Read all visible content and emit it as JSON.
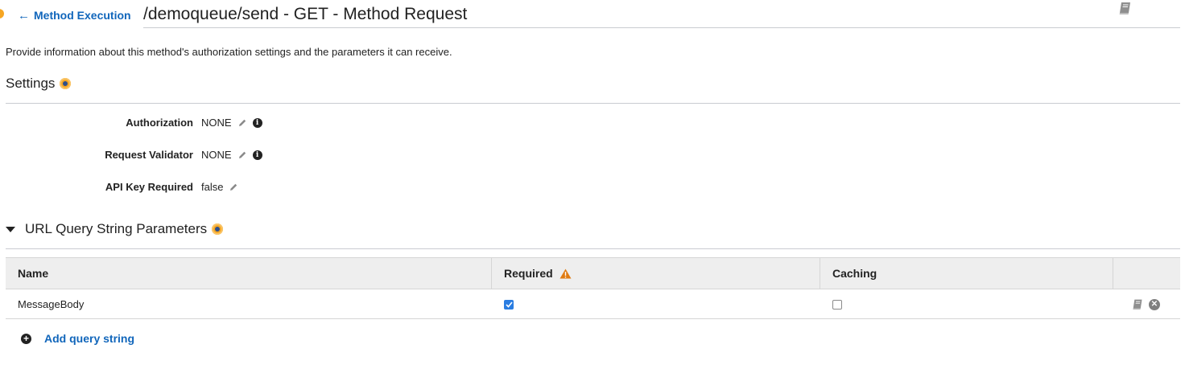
{
  "header": {
    "back_label": "Method Execution",
    "title": "/demoqueue/send - GET - Method Request"
  },
  "description": "Provide information about this method's authorization settings and the parameters it can receive.",
  "settings": {
    "title": "Settings",
    "fields": [
      {
        "label": "Authorization",
        "value": "NONE",
        "editable": true,
        "info": true
      },
      {
        "label": "Request Validator",
        "value": "NONE",
        "editable": true,
        "info": true
      },
      {
        "label": "API Key Required",
        "value": "false",
        "editable": true,
        "info": false
      }
    ]
  },
  "query_params": {
    "title": "URL Query String Parameters",
    "expanded": true,
    "columns": {
      "name": "Name",
      "required": "Required",
      "caching": "Caching"
    },
    "rows": [
      {
        "name": "MessageBody",
        "required": true,
        "caching": false
      }
    ],
    "add_label": "Add query string"
  },
  "icons": {
    "back": "arrow-left-icon",
    "docs": "book-icon",
    "help": "help-dot-icon",
    "edit": "pencil-icon",
    "info": "info-icon",
    "warning": "warning-icon",
    "delete": "remove-circle-icon",
    "add": "plus-circle-icon",
    "collapse": "caret-down-icon"
  },
  "colors": {
    "link": "#1166bb",
    "accent": "#f6a623",
    "warning": "#e07b12",
    "checkbox_checked": "#2a7de1",
    "table_header_bg": "#eeeeee"
  }
}
